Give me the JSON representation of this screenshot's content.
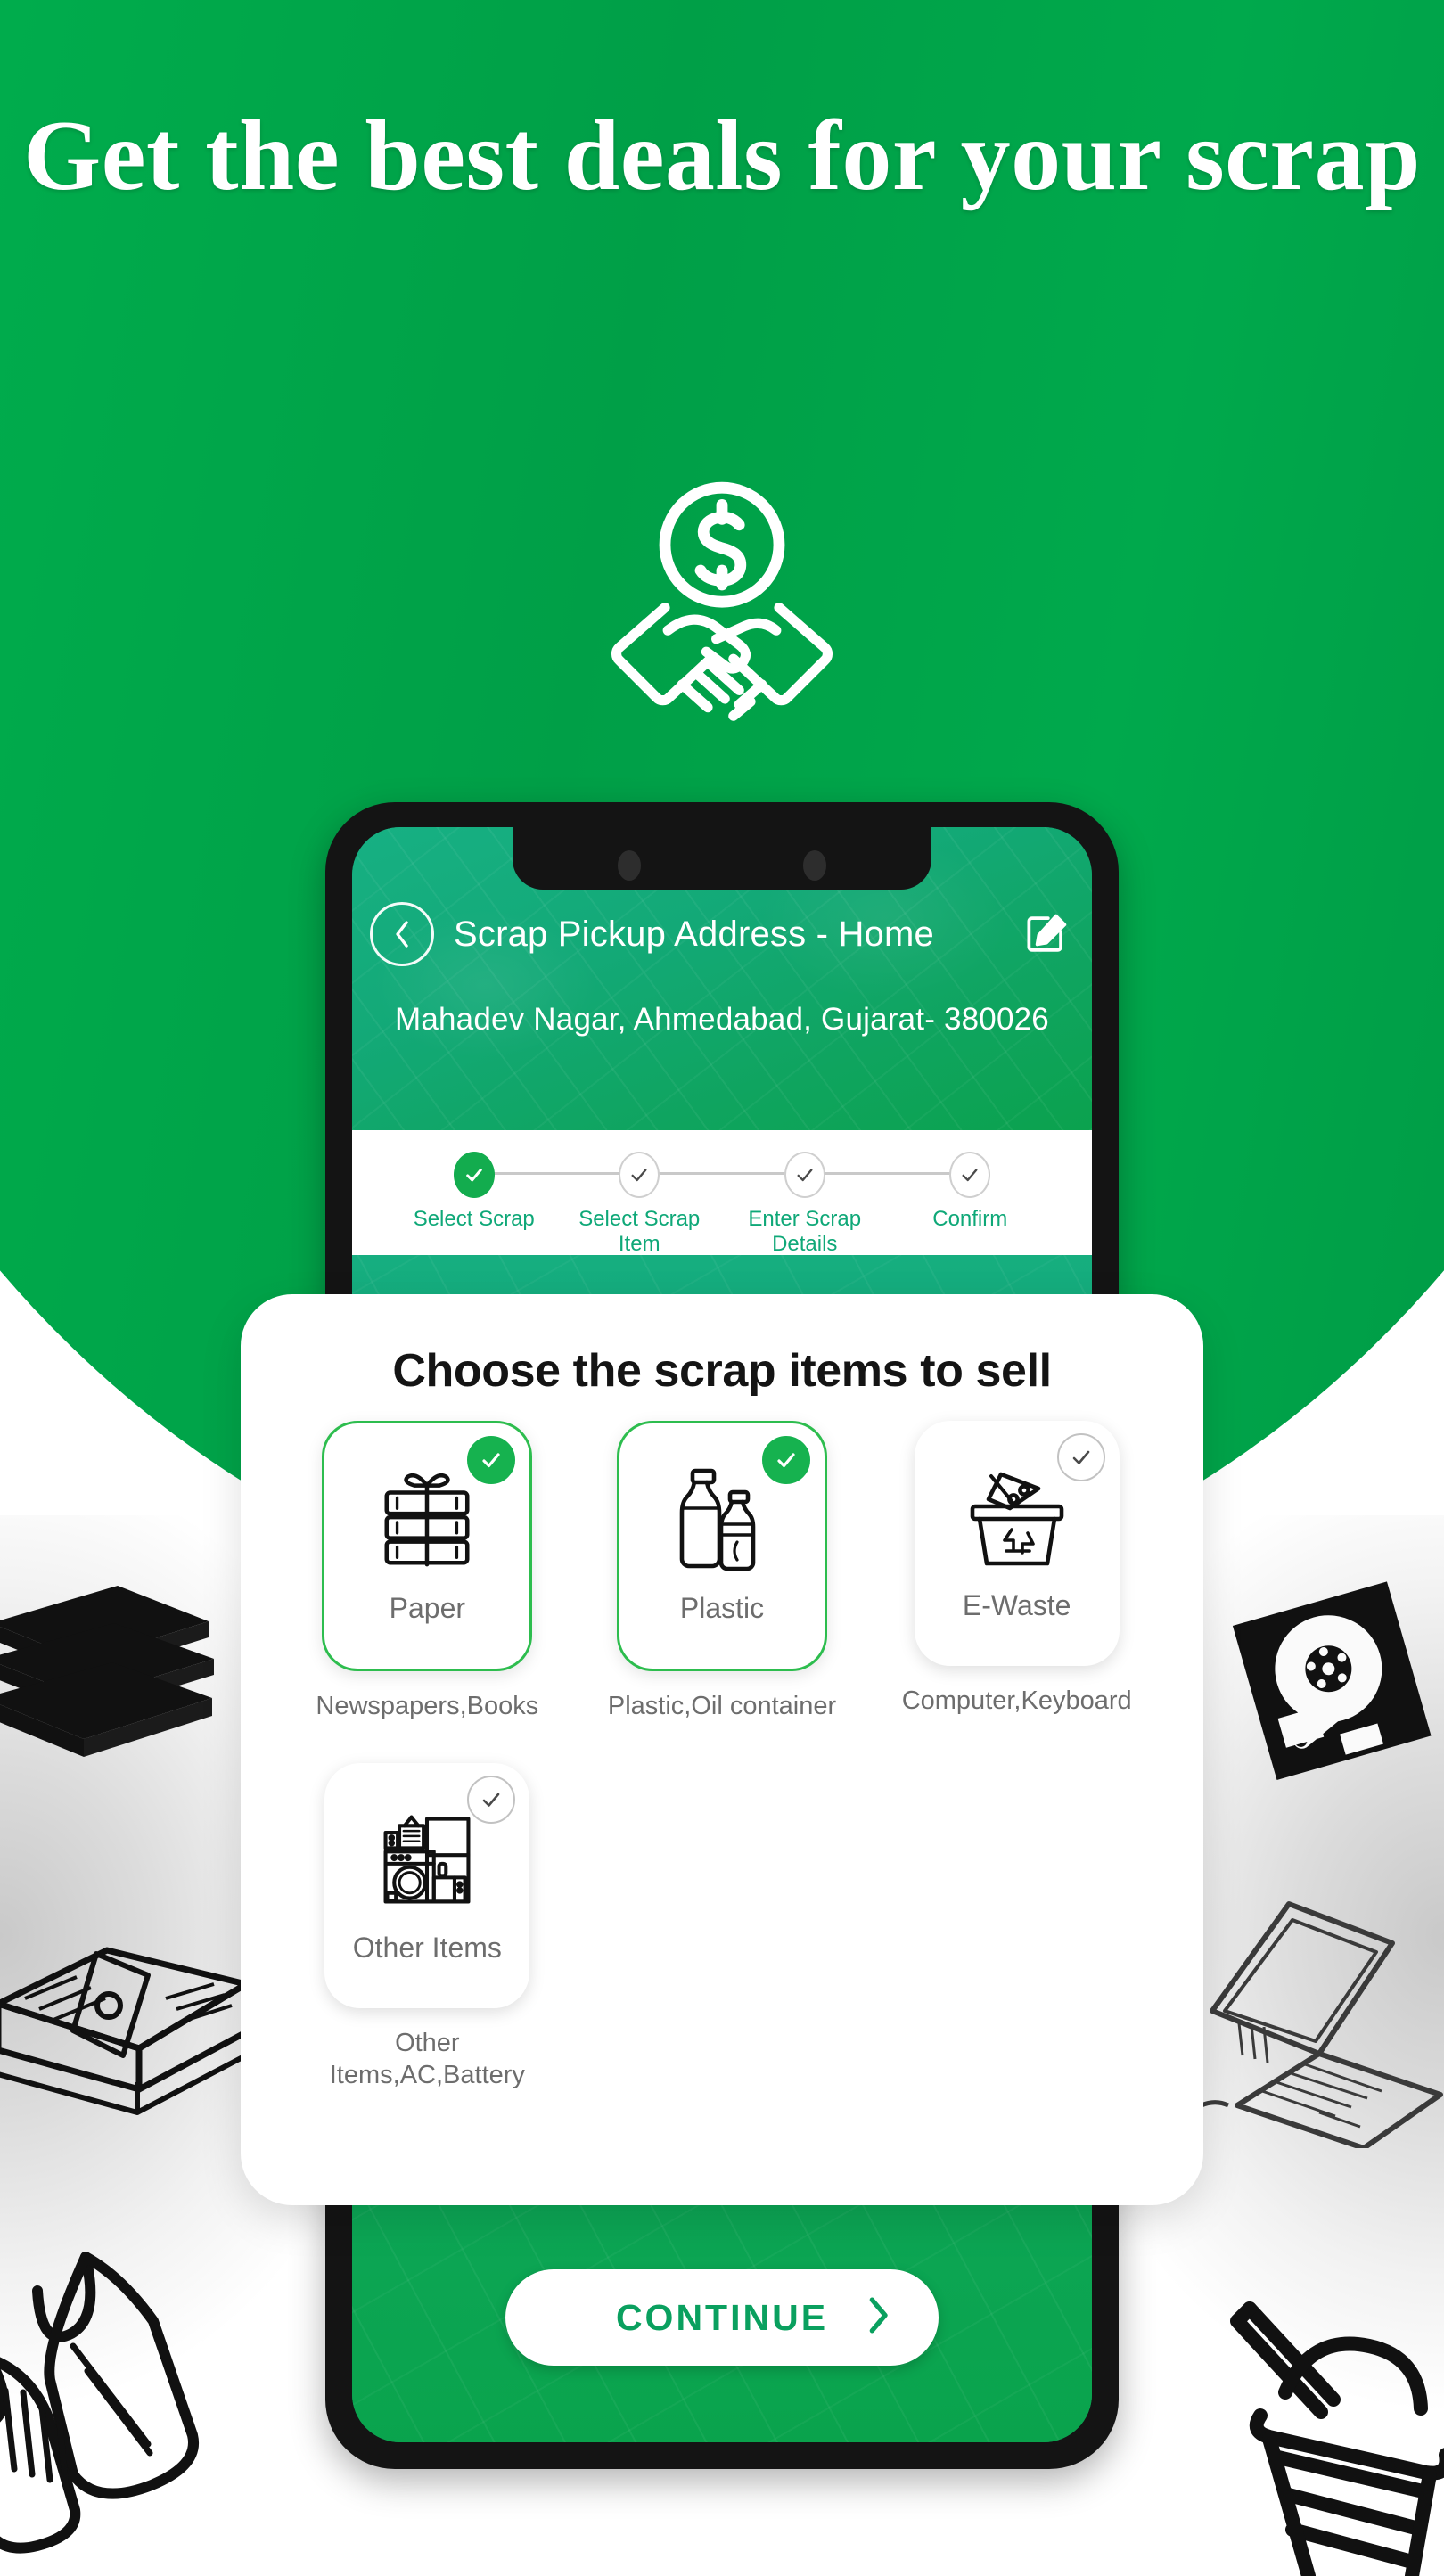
{
  "headline": "Get the best deals for your scrap",
  "hero_icon": "handshake-dollar-icon",
  "phone": {
    "app_bar": {
      "back_icon": "chevron-left-icon",
      "title": "Scrap Pickup Address - Home",
      "edit_icon": "edit-pencil-icon"
    },
    "address": "Mahadev Nagar, Ahmedabad, Gujarat- 380026",
    "stepper": [
      {
        "label": "Select Scrap",
        "state": "completed"
      },
      {
        "label": "Select Scrap\nItem",
        "state": "pending"
      },
      {
        "label": "Enter Scrap\nDetails",
        "state": "pending"
      },
      {
        "label": "Confirm",
        "state": "pending"
      }
    ],
    "continue_button": {
      "label": "CONTINUE",
      "arrow_icon": "chevron-right-icon"
    }
  },
  "sheet": {
    "title": "Choose the scrap items to sell",
    "items": [
      {
        "name": "Paper",
        "subtitle": "Newspapers,Books",
        "icon": "stacked-books-icon",
        "selected": true
      },
      {
        "name": "Plastic",
        "subtitle": "Plastic,Oil container",
        "icon": "plastic-bottles-icon",
        "selected": true
      },
      {
        "name": "E-Waste",
        "subtitle": "Computer,Keyboard",
        "icon": "ewaste-bin-icon",
        "selected": false
      },
      {
        "name": "Other Items",
        "subtitle": "Other\nItems,AC,Battery",
        "icon": "appliances-icon",
        "selected": false
      }
    ]
  },
  "decorations": [
    "stacked-books-illustration",
    "newspaper-bundle-illustration",
    "plastic-bags-illustration",
    "floppy-disk-illustration",
    "laptop-illustration",
    "plastic-cup-illustration"
  ],
  "colors": {
    "brand_green": "#00a94a",
    "app_teal": "#13a977",
    "accent_check": "#16b24f",
    "step_label": "#0fa878",
    "continue_text": "#0aa05f"
  }
}
